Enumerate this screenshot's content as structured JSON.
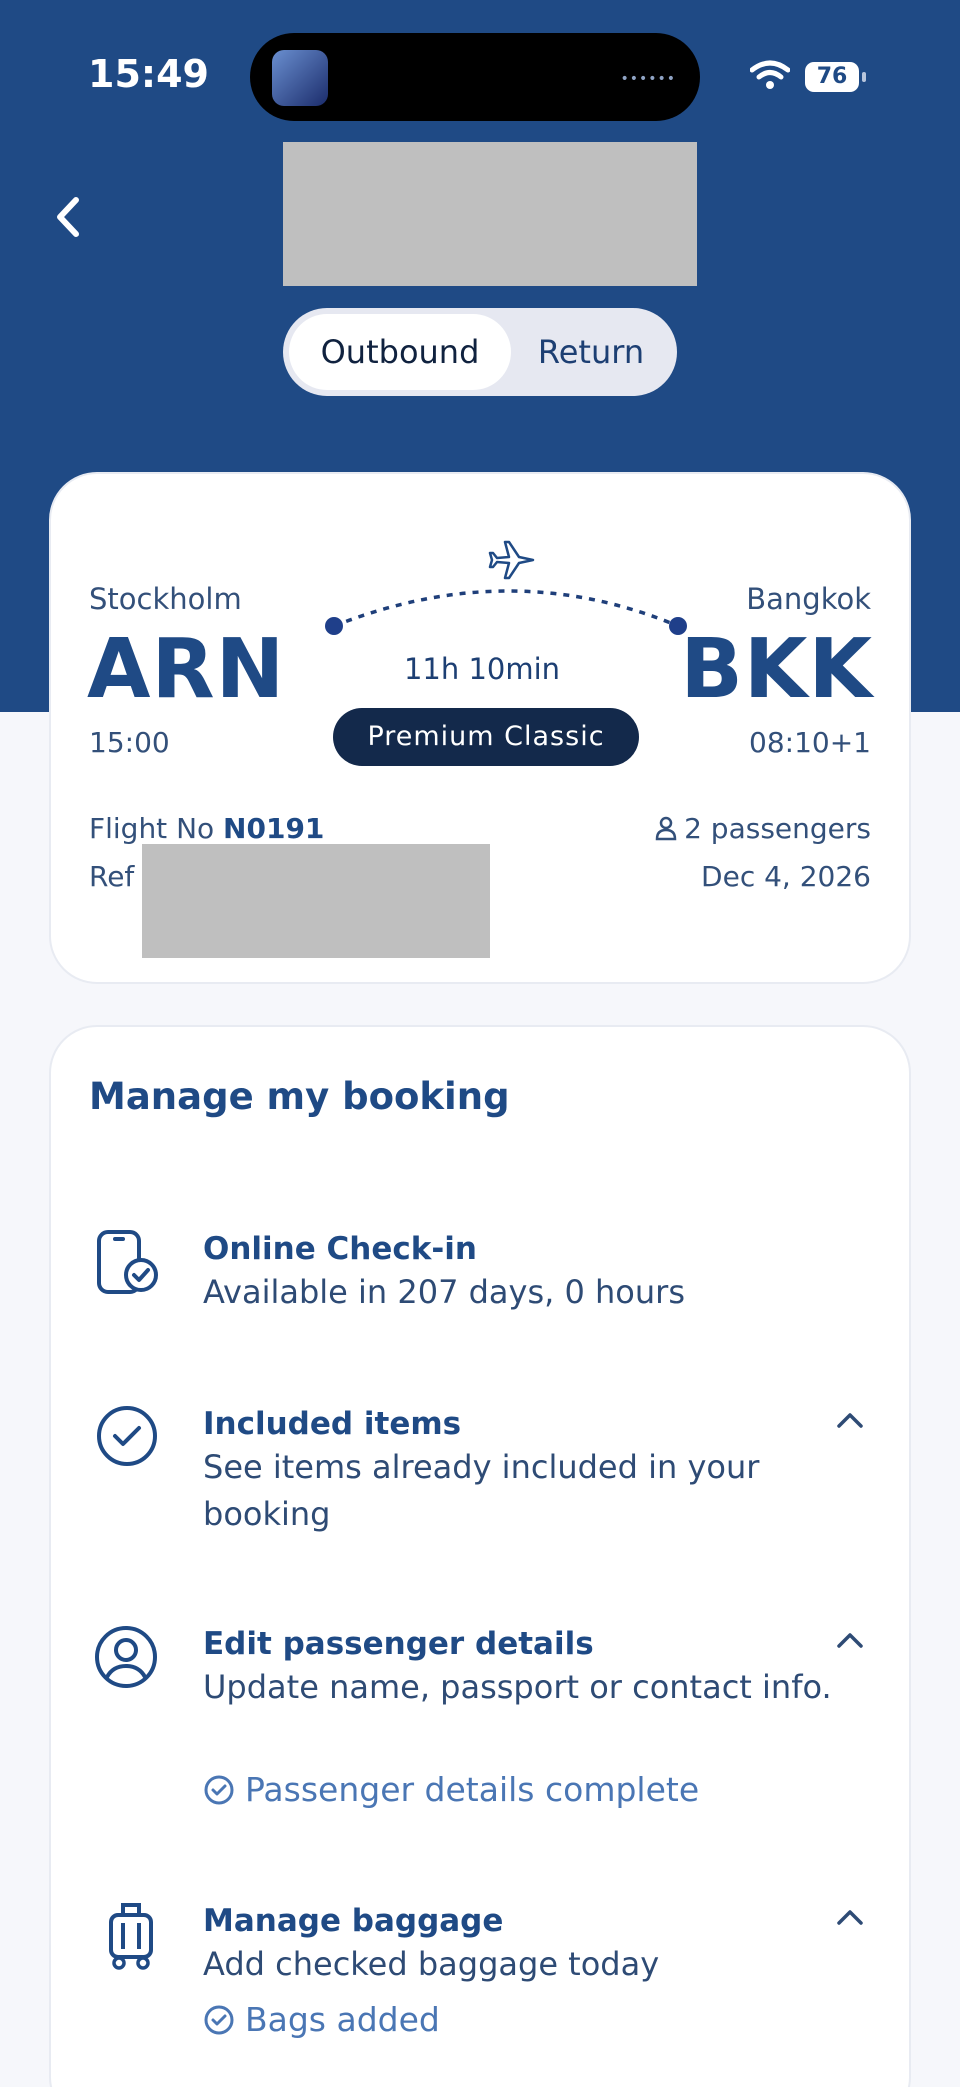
{
  "status_bar": {
    "time": "15:49",
    "battery": "76"
  },
  "toggle": {
    "outbound": "Outbound",
    "return": "Return"
  },
  "flight": {
    "origin_city": "Stockholm",
    "origin_code": "ARN",
    "origin_time": "15:00",
    "dest_city": "Bangkok",
    "dest_code": "BKK",
    "dest_time": "08:10+1",
    "duration": "11h 10min",
    "cabin": "Premium Classic",
    "flight_no_label": "Flight No",
    "flight_no": "N0191",
    "ref_label": "Ref",
    "passengers": "2 passengers",
    "date": "Dec 4, 2026"
  },
  "booking": {
    "title": "Manage my booking",
    "items": [
      {
        "title": "Online Check-in",
        "desc": "Available in 207 days, 0 hours",
        "icon": "phone-check-icon"
      },
      {
        "title": "Included items",
        "desc": "See items already included in your booking",
        "icon": "check-circle-icon"
      },
      {
        "title": "Edit passenger details",
        "desc": "Update name, passport or contact info.",
        "status": "Passenger details complete",
        "icon": "user-circle-icon"
      },
      {
        "title": "Manage baggage",
        "desc": "Add checked baggage today",
        "status": "Bags added",
        "icon": "luggage-icon"
      }
    ]
  },
  "colors": {
    "header": "#1f4a85",
    "badge": "#13294b",
    "status_green": "#4a76b4"
  }
}
